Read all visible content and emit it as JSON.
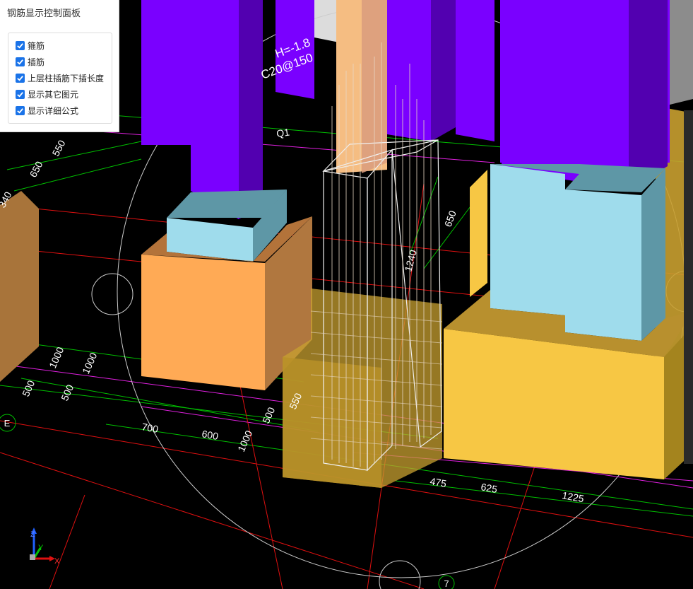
{
  "panel": {
    "title": "钢筋显示控制面板",
    "options": [
      {
        "label": "箍筋",
        "checked": true
      },
      {
        "label": "插筋",
        "checked": true
      },
      {
        "label": "上层柱插筋下插长度",
        "checked": true
      },
      {
        "label": "显示其它图元",
        "checked": true
      },
      {
        "label": "显示详细公式",
        "checked": true
      }
    ]
  },
  "viewport": {
    "dimensions": {
      "d1": "550",
      "d2": "650",
      "d3": "340",
      "d4": "650",
      "d5": "1240",
      "d6": "1000",
      "d7": "1000",
      "d8": "500",
      "d9": "500",
      "d10": "700",
      "d11": "600",
      "d12": "550",
      "d13": "500",
      "d14": "1000",
      "d15": "475",
      "d16": "625",
      "d17": "1225"
    },
    "annotations": {
      "elevation": "H=-1.8",
      "rebar_spec": "C20@150",
      "beam": "Q1"
    },
    "grid_labels": {
      "e": "E",
      "seven": "7"
    },
    "axes": {
      "z": "Z",
      "y": "Y",
      "x": "X"
    }
  },
  "colors": {
    "column": "#7a00ff",
    "column_side": "#5200b0",
    "cap": "#9fdcec",
    "footing_orange": "#ffaa55",
    "footing_yellow": "#f7c744",
    "checkbox": "#1a73e8"
  }
}
